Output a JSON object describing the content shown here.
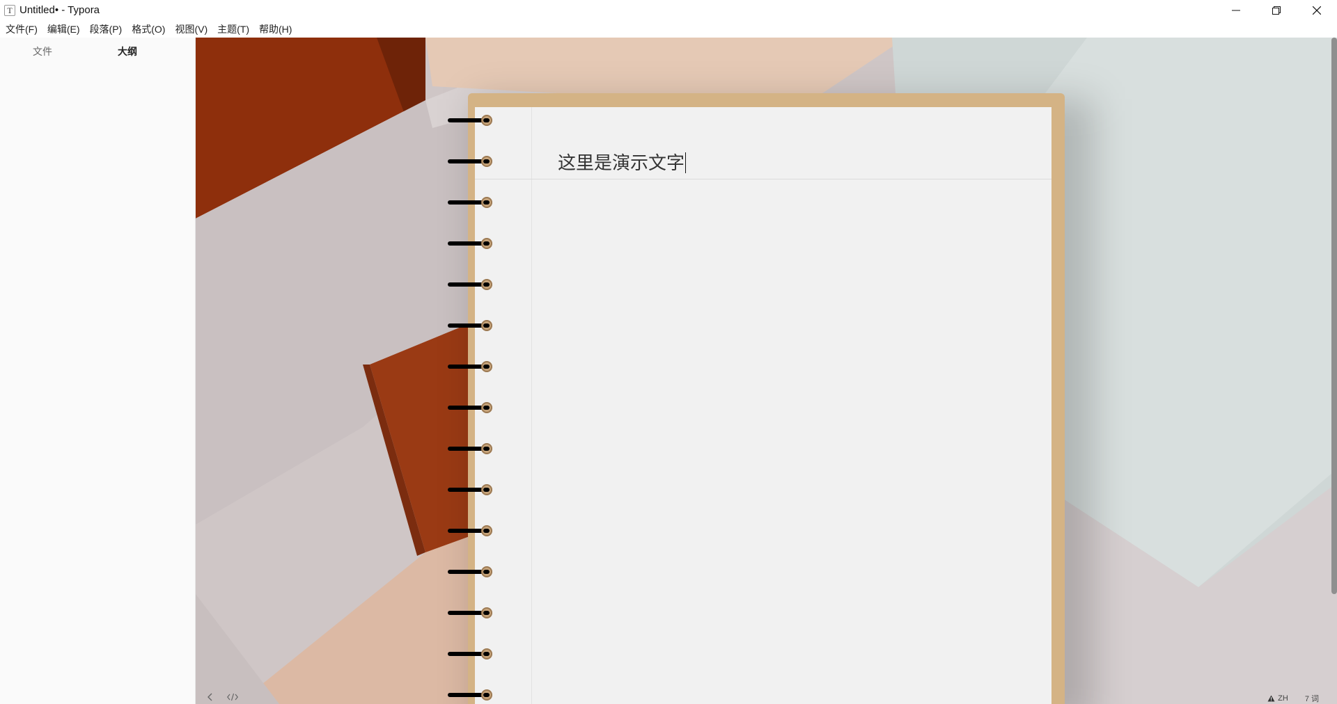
{
  "window": {
    "icon_glyph": "T",
    "title": "Untitled• - Typora",
    "controls": [
      "minimize-icon",
      "restore-icon",
      "close-icon"
    ]
  },
  "menu": {
    "items": [
      {
        "label": "文件(F)"
      },
      {
        "label": "编辑(E)"
      },
      {
        "label": "段落(P)"
      },
      {
        "label": "格式(O)"
      },
      {
        "label": "视图(V)"
      },
      {
        "label": "主题(T)"
      },
      {
        "label": "帮助(H)"
      }
    ]
  },
  "sidebar": {
    "tabs": [
      {
        "label": "文件",
        "active": false
      },
      {
        "label": "大纲",
        "active": true
      }
    ]
  },
  "document": {
    "heading": "这里是演示文字"
  },
  "footer": {
    "buttons": [
      "chevron-left-icon",
      "code-icon"
    ]
  },
  "status": {
    "language_icon": "warning-triangle-icon",
    "language": "ZH",
    "word_count": "7 词"
  },
  "colors": {
    "cover": "#d4b385",
    "page": "#f1f1f1",
    "rust": "#9a3a14",
    "background_tan": "#e6cbb8",
    "background_gray": "#c8c4c4",
    "background_blue": "#d3dcdb"
  }
}
